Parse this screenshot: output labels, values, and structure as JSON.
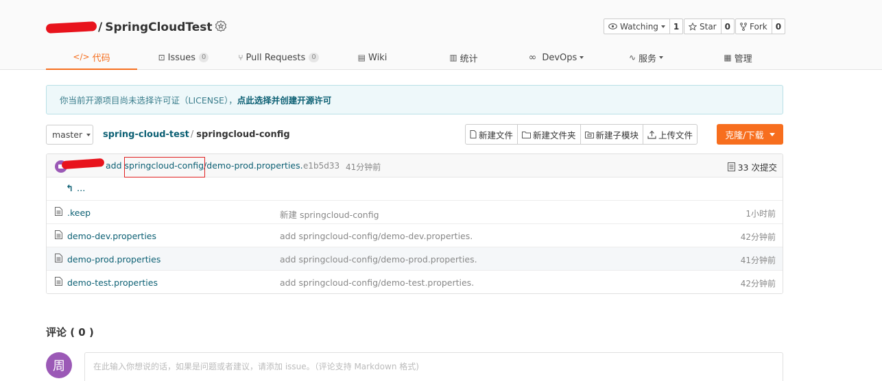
{
  "repo": {
    "name": "SpringCloudTest",
    "slash": "/"
  },
  "actions": {
    "watch_label": "Watching",
    "watch_count": "1",
    "star_label": "Star",
    "star_count": "0",
    "fork_label": "Fork",
    "fork_count": "0"
  },
  "tabs": [
    {
      "label": "代码",
      "icon": "code-icon"
    },
    {
      "label": "Issues",
      "count": "0",
      "icon": "issues-icon"
    },
    {
      "label": "Pull Requests",
      "count": "0",
      "icon": "pull-request-icon"
    },
    {
      "label": "Wiki",
      "icon": "wiki-icon"
    },
    {
      "label": "统计",
      "icon": "stats-icon"
    },
    {
      "label": "DevOps",
      "icon": "devops-icon"
    },
    {
      "label": "服务",
      "icon": "service-icon"
    },
    {
      "label": "管理",
      "icon": "manage-icon"
    }
  ],
  "license": {
    "text": "你当前开源项目尚未选择许可证（LICENSE），",
    "link": "点此选择并创建开源许可"
  },
  "branch": "master",
  "breadcrumb": {
    "root": "spring-cloud-test",
    "sep": "/",
    "current": "springcloud-config"
  },
  "toolbar": {
    "new_file": "新建文件",
    "new_folder": "新建文件夹",
    "new_submodule": "新建子模块",
    "upload": "上传文件",
    "clone": "克隆/下载"
  },
  "commit": {
    "verb": "add",
    "path_highlight": "springcloud-config/",
    "path_rest": "demo-prod.properties.",
    "hash": "e1b5d33",
    "time": "41分钟前",
    "count_label": "33 次提交"
  },
  "up_label": "...",
  "files": [
    {
      "name": ".keep",
      "message": "新建 springcloud-config",
      "time": "1小时前"
    },
    {
      "name": "demo-dev.properties",
      "message": "add springcloud-config/demo-dev.properties.",
      "time": "42分钟前"
    },
    {
      "name": "demo-prod.properties",
      "message": "add springcloud-config/demo-prod.properties.",
      "time": "41分钟前"
    },
    {
      "name": "demo-test.properties",
      "message": "add springcloud-config/demo-test.properties.",
      "time": "42分钟前"
    }
  ],
  "comments": {
    "title": "评论 ( 0 )",
    "avatar_char": "周",
    "placeholder": "在此输入你想说的话，如果是问题或者建议，请添加 issue。（评论支持 Markdown 格式)"
  },
  "colors": {
    "accent": "#f56e1e",
    "link": "#0b5f73",
    "avatar": "#9b59b6"
  }
}
